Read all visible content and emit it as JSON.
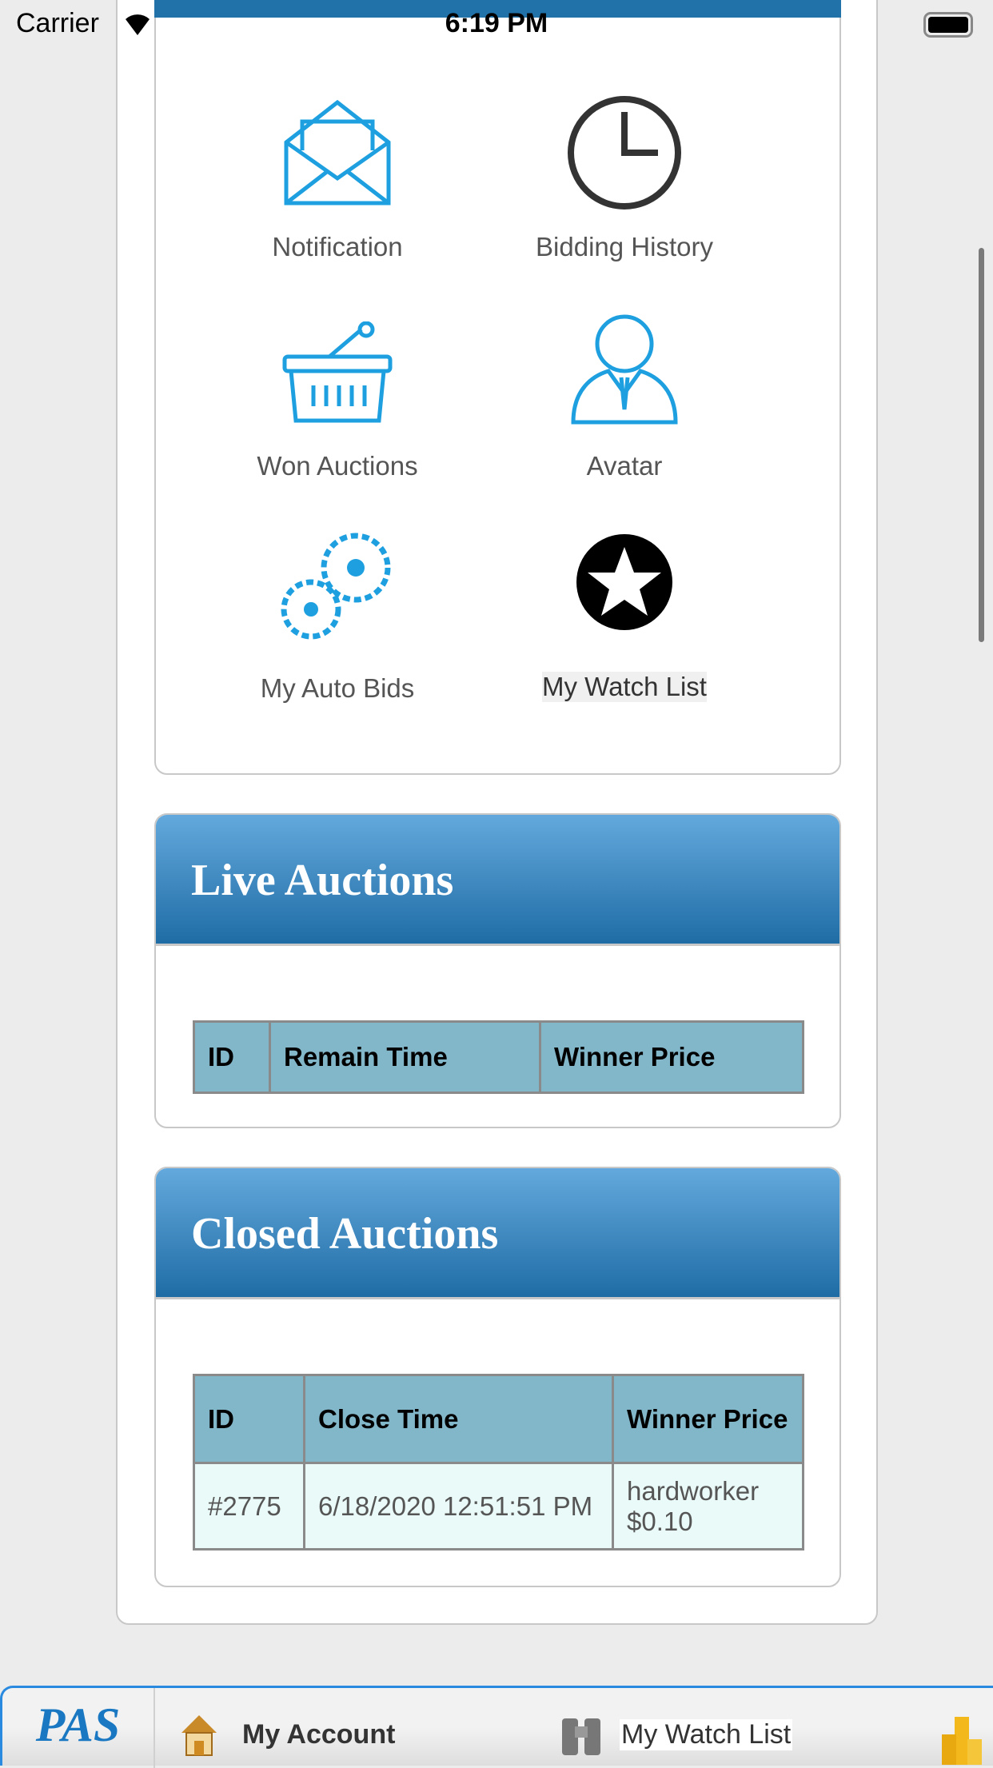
{
  "status_bar": {
    "carrier": "Carrier",
    "time": "6:19 PM"
  },
  "menu": {
    "items": [
      {
        "label": "Notification",
        "icon": "envelope-icon"
      },
      {
        "label": "Bidding History",
        "icon": "clock-icon"
      },
      {
        "label": "Won Auctions",
        "icon": "basket-icon"
      },
      {
        "label": "Avatar",
        "icon": "avatar-icon"
      },
      {
        "label": "My Auto Bids",
        "icon": "gears-icon"
      },
      {
        "label": "My Watch List",
        "icon": "star-icon"
      }
    ]
  },
  "live_auctions": {
    "title": "Live Auctions",
    "columns": [
      "ID",
      "Remain Time",
      "Winner Price"
    ],
    "rows": []
  },
  "closed_auctions": {
    "title": "Closed Auctions",
    "columns": [
      "ID",
      "Close Time",
      "Winner Price"
    ],
    "rows": [
      {
        "id": "#2775",
        "close_time": "6/18/2020 12:51:51 PM",
        "winner": "hardworker",
        "price": "$0.10"
      }
    ]
  },
  "tab_bar": {
    "logo": "PAS",
    "tabs": [
      {
        "label": "My Account",
        "icon": "house-icon"
      },
      {
        "label": "My Watch List",
        "icon": "binoculars-icon"
      },
      {
        "icon": "coins-icon"
      }
    ]
  },
  "colors": {
    "accent": "#2272aa",
    "icon_blue": "#1ea0e0",
    "table_header": "#82b6c9"
  }
}
